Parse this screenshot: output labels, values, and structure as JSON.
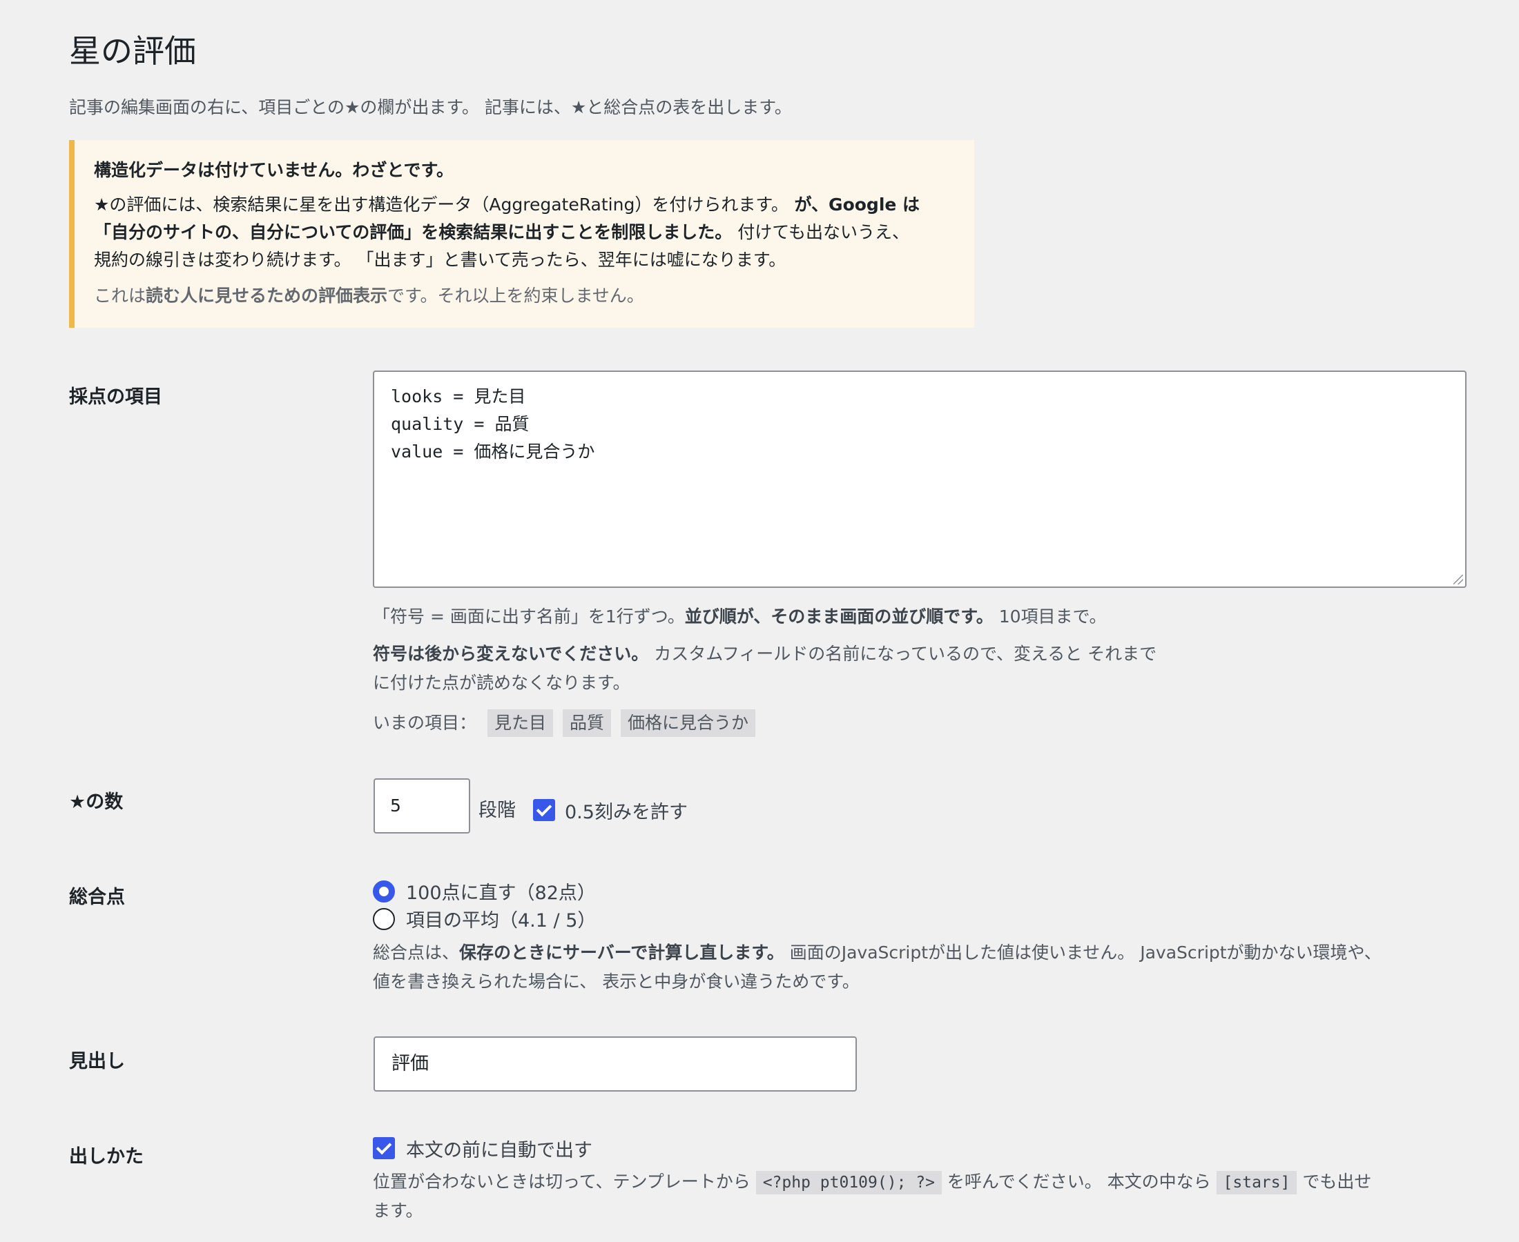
{
  "page": {
    "title": "星の評価",
    "intro": "記事の編集画面の右に、項目ごとの★の欄が出ます。 記事には、★と総合点の表を出します。"
  },
  "notice": {
    "title": "構造化データは付けていません。わざとです。",
    "line1_a": "★の評価には、検索結果に星を出す構造化データ（AggregateRating）を付けられます。",
    "line1_b": " が、Google は",
    "line2_a": "「自分のサイトの、自分についての評価」を検索結果に出すことを制限しました。",
    "line2_b": " 付けても出ないうえ、",
    "line3": "規約の線引きは変わり続けます。 「出ます」と書いて売ったら、翌年には嘘になります。",
    "foot_a": "これは",
    "foot_b": "読む人に見せるための評価表示",
    "foot_c": "です。それ以上を約束しません。"
  },
  "items_section": {
    "label": "採点の項目",
    "textarea_value": "looks = 見た目\nquality = 品質\nvalue = 価格に見合うか",
    "help1_a": "「符号 = 画面に出す名前」を1行ずつ。",
    "help1_b": "並び順が、そのまま画面の並び順です。",
    "help1_c": " 10項目まで。",
    "help2_a": "符号は後から変えないでください。",
    "help2_b": " カスタムフィールドの名前になっているので、変えると それまで",
    "help2_c": "に付けた点が読めなくなります。",
    "current_label": "いまの項目：",
    "tags": [
      "見た目",
      "品質",
      "価格に見合うか"
    ]
  },
  "stars_section": {
    "label": "★の数",
    "value": "5",
    "unit": "段階",
    "half_label": "0.5刻みを許す",
    "half_checked": true
  },
  "total_section": {
    "label": "総合点",
    "option1": "100点に直す（82点）",
    "option2": "項目の平均（4.1 / 5）",
    "selected": "option1",
    "desc1_a": "総合点は、",
    "desc1_b": "保存のときにサーバーで計算し直します。",
    "desc1_c": " 画面のJavaScriptが出した値は使いません。 JavaScriptが動かない環境や、",
    "desc2": "値を書き換えられた場合に、 表示と中身が食い違うためです。"
  },
  "heading_section": {
    "label": "見出し",
    "value": "評価"
  },
  "display_section": {
    "label": "出しかた",
    "auto_label": "本文の前に自動で出す",
    "auto_checked": true,
    "desc1_a": "位置が合わないときは切って、テンプレートから ",
    "code1": "<?php pt0109(); ?>",
    "desc1_b": " を呼んでください。 本文の中なら ",
    "code2": "[stars]",
    "desc1_c": " でも出せ",
    "desc2": "ます。"
  },
  "colors": {
    "accent": "#3858e9",
    "notice_border": "#f0b849",
    "notice_bg": "#fcf6eb"
  }
}
